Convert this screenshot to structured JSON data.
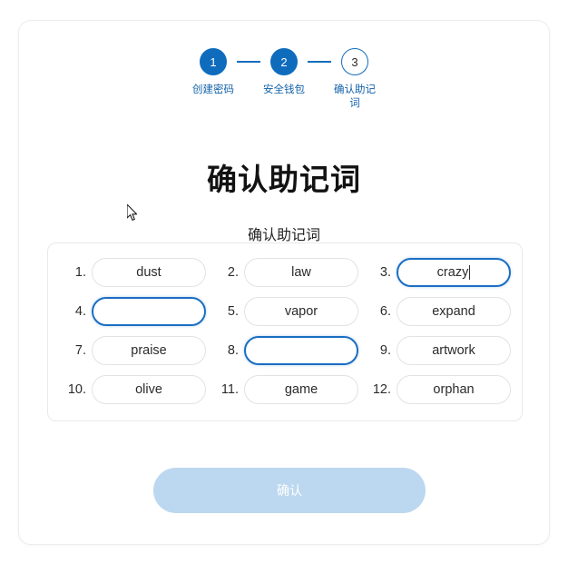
{
  "stepper": {
    "steps": [
      {
        "number": "1",
        "label": "创建密码",
        "state": "done"
      },
      {
        "number": "2",
        "label": "安全钱包",
        "state": "done"
      },
      {
        "number": "3",
        "label": "确认助记词",
        "state": "todo"
      }
    ]
  },
  "page": {
    "title": "确认助记词",
    "subtitle": "确认助记词"
  },
  "words": [
    {
      "index": "1.",
      "value": "dust",
      "focused": false,
      "caret": false
    },
    {
      "index": "2.",
      "value": "law",
      "focused": false,
      "caret": false
    },
    {
      "index": "3.",
      "value": "crazy",
      "focused": true,
      "caret": true
    },
    {
      "index": "4.",
      "value": "",
      "focused": true,
      "caret": false
    },
    {
      "index": "5.",
      "value": "vapor",
      "focused": false,
      "caret": false
    },
    {
      "index": "6.",
      "value": "expand",
      "focused": false,
      "caret": false
    },
    {
      "index": "7.",
      "value": "praise",
      "focused": false,
      "caret": false
    },
    {
      "index": "8.",
      "value": "",
      "focused": true,
      "caret": false
    },
    {
      "index": "9.",
      "value": "artwork",
      "focused": false,
      "caret": false
    },
    {
      "index": "10.",
      "value": "olive",
      "focused": false,
      "caret": false
    },
    {
      "index": "11.",
      "value": "game",
      "focused": false,
      "caret": false
    },
    {
      "index": "12.",
      "value": "orphan",
      "focused": false,
      "caret": false
    }
  ],
  "confirm": {
    "label": "确认"
  },
  "colors": {
    "accent": "#0f6cbd",
    "focus_border": "#1b6ec2",
    "step_label": "#1262a8",
    "button_disabled": "#bcd8f0",
    "input_border": "#e2e2e2"
  }
}
